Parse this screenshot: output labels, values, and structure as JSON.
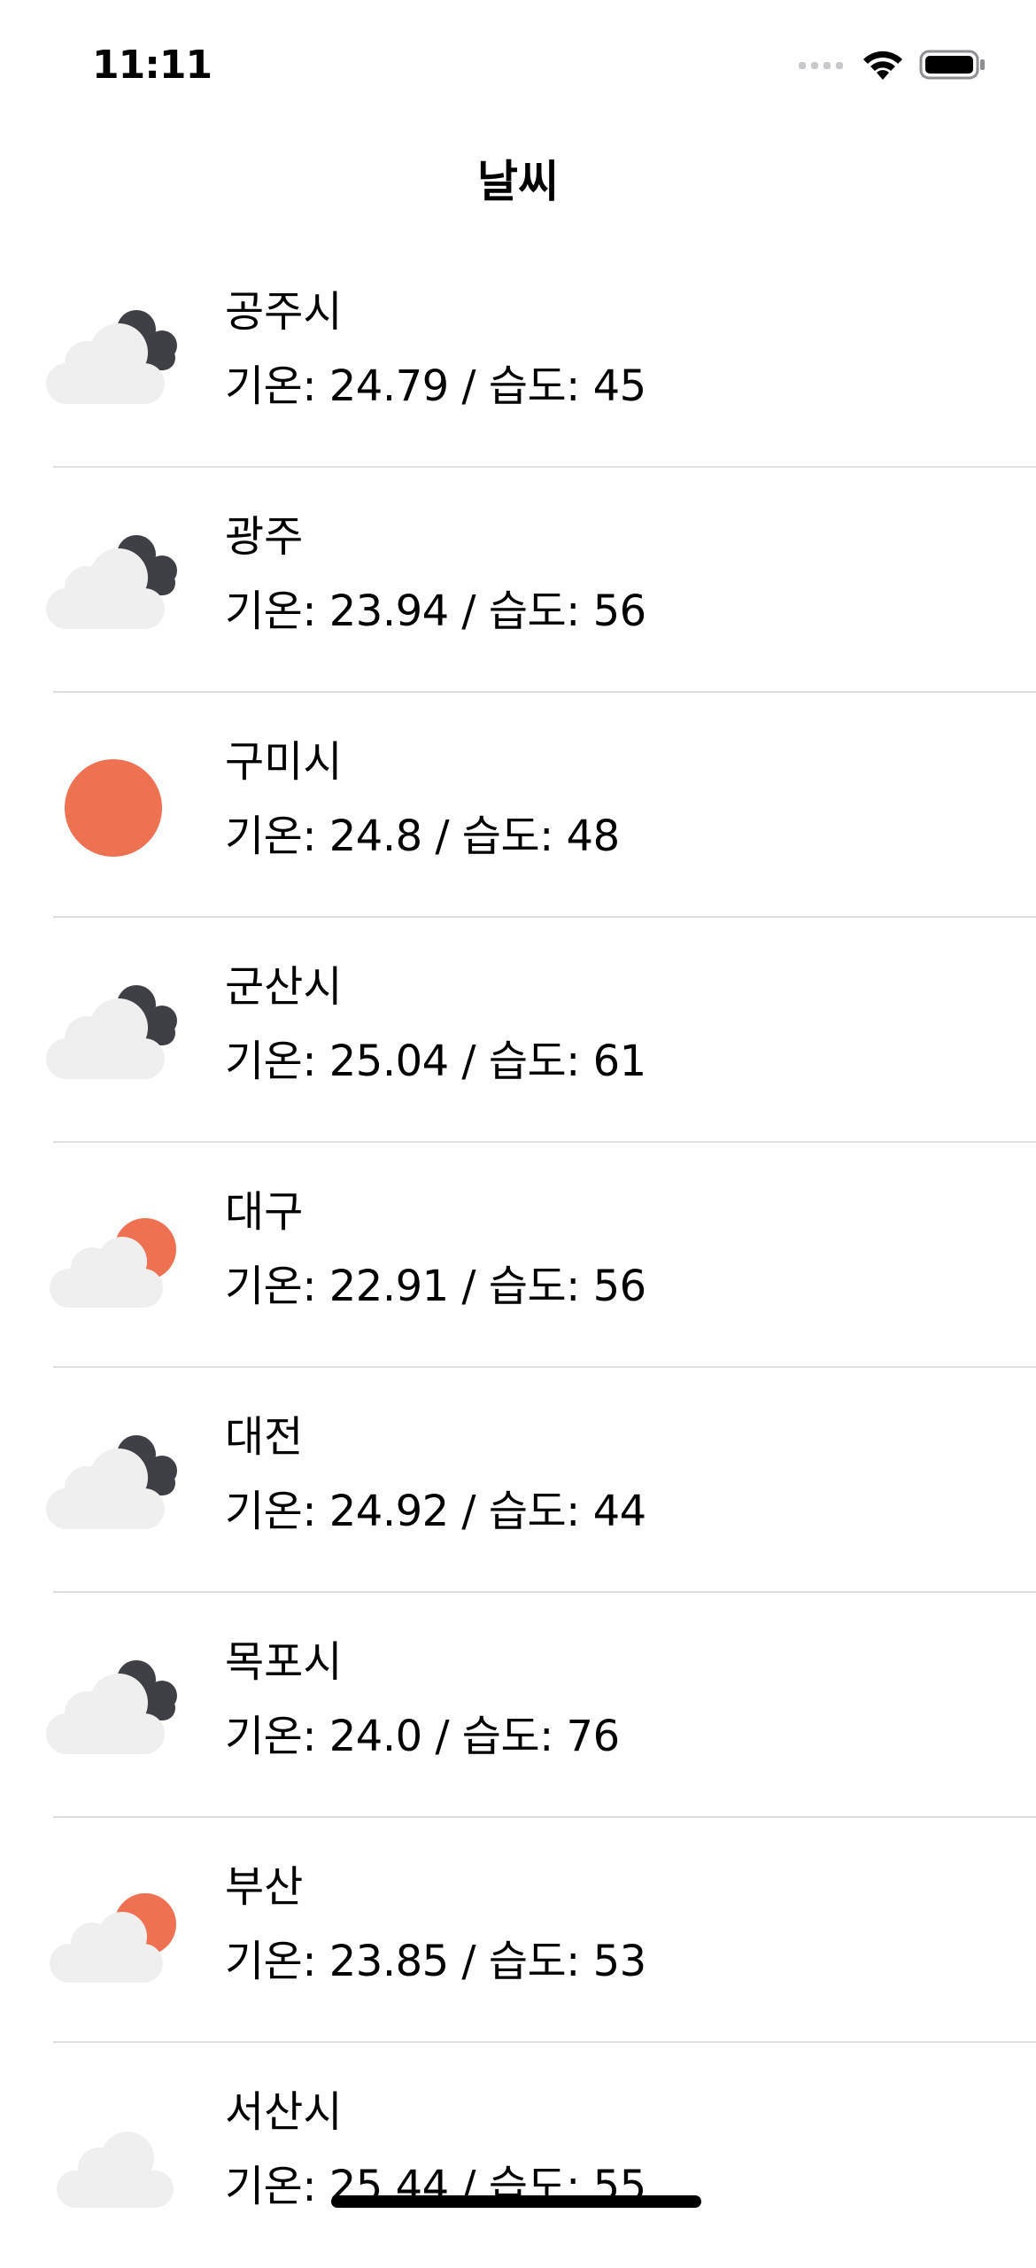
{
  "status_bar": {
    "time": "11:11",
    "signal_icon": "cellular-signal-icon",
    "wifi_icon": "wifi-icon",
    "battery_icon": "battery-icon"
  },
  "nav": {
    "title": "날씨"
  },
  "colors": {
    "sun": "#EE7152",
    "dark_cloud": "#3F4045",
    "light_cloud": "#EFEFEF",
    "divider": "#E0E0E3"
  },
  "list": {
    "items": [
      {
        "city": "공주시",
        "detail": "기온: 24.79 / 습도: 45",
        "icon": "cloudy-dark-icon"
      },
      {
        "city": "광주",
        "detail": "기온: 23.94 / 습도: 56",
        "icon": "cloudy-dark-icon"
      },
      {
        "city": "구미시",
        "detail": "기온: 24.8 / 습도: 48",
        "icon": "sunny-icon"
      },
      {
        "city": "군산시",
        "detail": "기온: 25.04 / 습도: 61",
        "icon": "cloudy-dark-icon"
      },
      {
        "city": "대구",
        "detail": "기온: 22.91 / 습도: 56",
        "icon": "partly-cloudy-icon"
      },
      {
        "city": "대전",
        "detail": "기온: 24.92 / 습도: 44",
        "icon": "cloudy-dark-icon"
      },
      {
        "city": "목포시",
        "detail": "기온: 24.0 / 습도: 76",
        "icon": "cloudy-dark-icon"
      },
      {
        "city": "부산",
        "detail": "기온: 23.85 / 습도: 53",
        "icon": "partly-cloudy-icon"
      },
      {
        "city": "서산시",
        "detail": "기온: 25.44 / 습도: 55",
        "icon": "cloud-icon"
      }
    ]
  }
}
